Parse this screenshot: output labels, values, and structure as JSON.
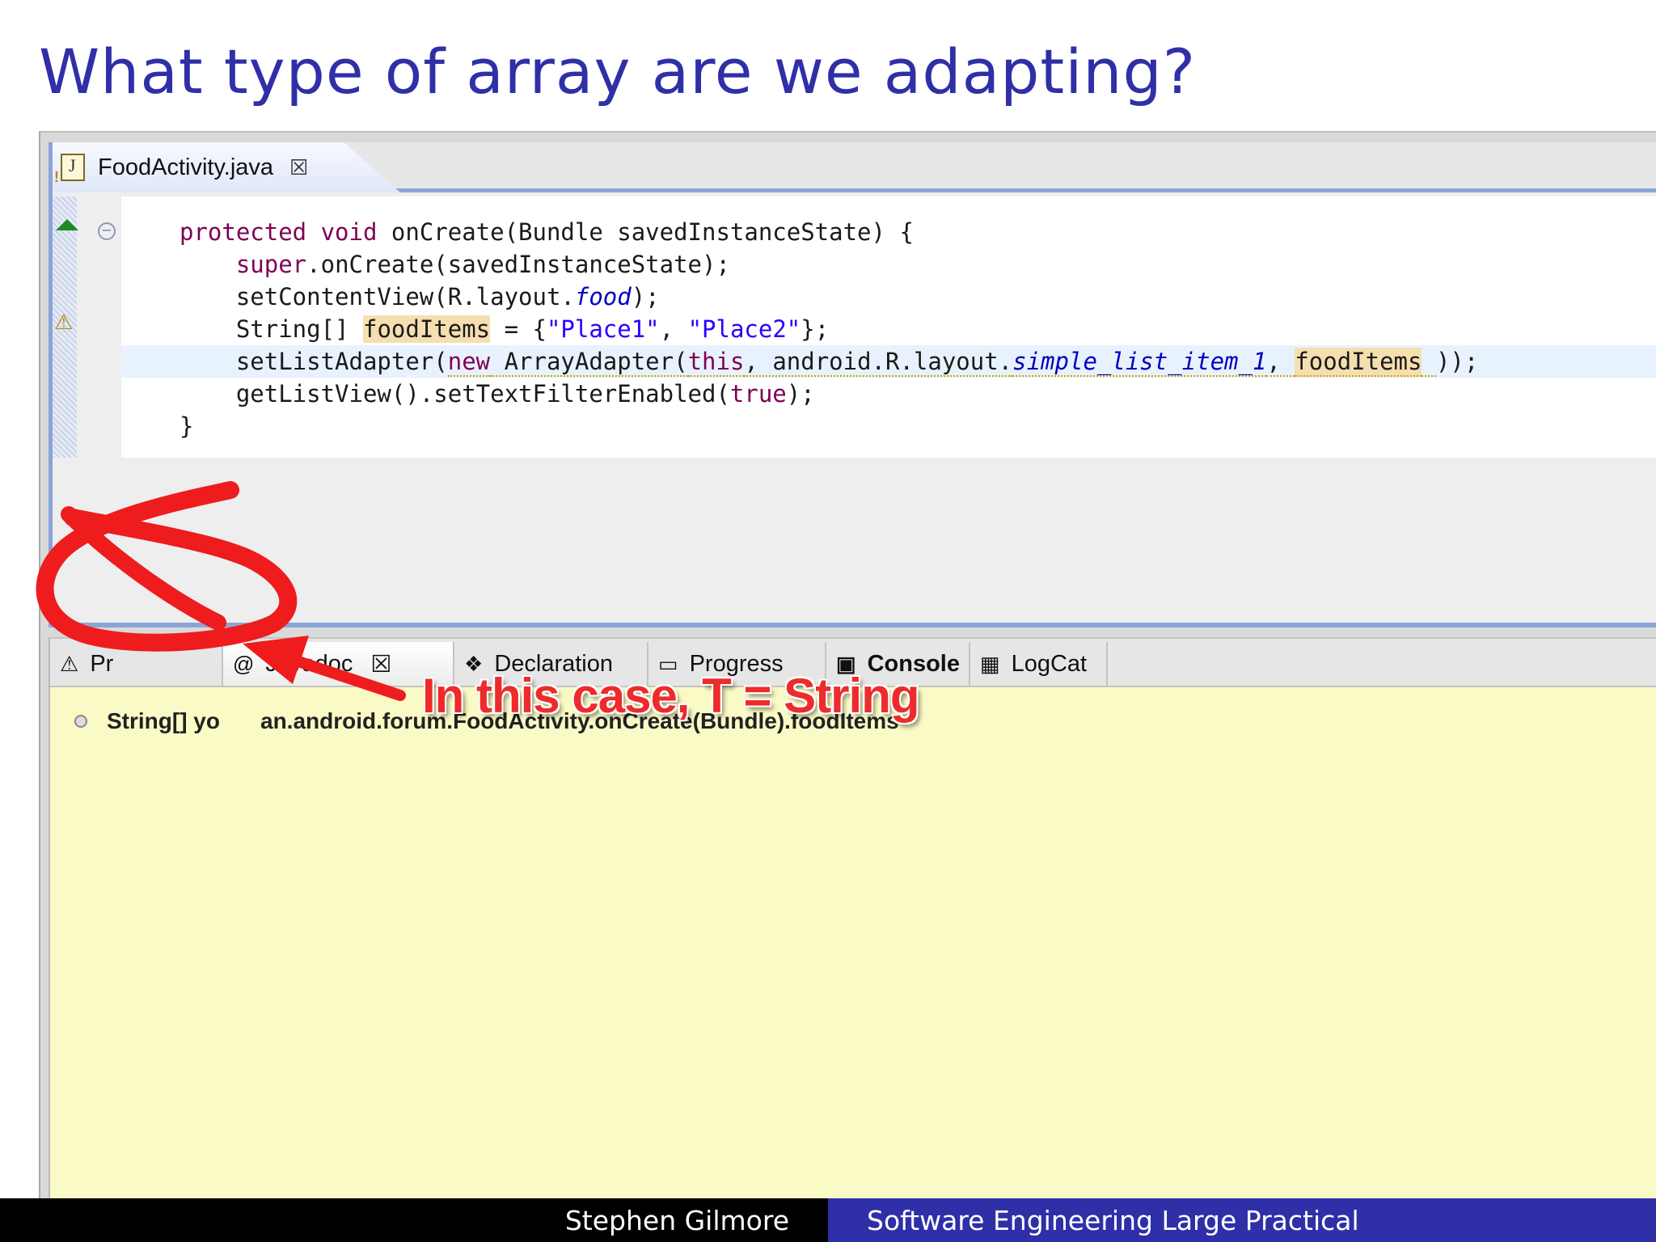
{
  "slide": {
    "title": "What type of array are we adapting?"
  },
  "editor": {
    "tab_label": "FoodActivity.java",
    "tab_close": "☒",
    "code_lines": [
      {
        "tokens": [
          {
            "t": "protected void",
            "c": "kw"
          },
          {
            "t": " onCreate(Bundle savedInstanceState) {"
          }
        ]
      },
      {
        "tokens": [
          {
            "t": "    "
          },
          {
            "t": "super",
            "c": "kw"
          },
          {
            "t": ".onCreate(savedInstanceState);"
          }
        ]
      },
      {
        "tokens": [
          {
            "t": "    setContentView(R.layout."
          },
          {
            "t": "food",
            "c": "ital"
          },
          {
            "t": ");"
          }
        ]
      },
      {
        "tokens": [
          {
            "t": "    String[] "
          },
          {
            "t": "foodItems",
            "c": "occ"
          },
          {
            "t": " = {"
          },
          {
            "t": "\"Place1\"",
            "c": "str"
          },
          {
            "t": ", "
          },
          {
            "t": "\"Place2\"",
            "c": "str"
          },
          {
            "t": "};"
          }
        ]
      },
      {
        "tokens": [
          {
            "t": "    setListAdapter("
          },
          {
            "t": "new",
            "c": "kw warn"
          },
          {
            "t": " ArrayAdapter(",
            "c": "warn"
          },
          {
            "t": "this",
            "c": "kw warn"
          },
          {
            "t": ", android.R.layout.",
            "c": "warn"
          },
          {
            "t": "simple_list_item_1",
            "c": "ital warn"
          },
          {
            "t": ", ",
            "c": "warn"
          },
          {
            "t": "foodItems",
            "c": "occ warn"
          },
          {
            "t": " ",
            "c": "warn"
          },
          {
            "t": "));"
          }
        ],
        "highlight": true
      },
      {
        "tokens": [
          {
            "t": "    getListView().setTextFilterEnabled("
          },
          {
            "t": "true",
            "c": "kw"
          },
          {
            "t": ");"
          }
        ]
      },
      {
        "tokens": [
          {
            "t": "}"
          }
        ]
      }
    ]
  },
  "panel": {
    "tabs": [
      {
        "label": "Pr",
        "icon": "problems-icon"
      },
      {
        "label": "Javadoc",
        "icon": "at-icon",
        "active": true,
        "close": "☒"
      },
      {
        "label": "Declaration",
        "icon": "declaration-icon"
      },
      {
        "label": "Progress",
        "icon": "progress-icon"
      },
      {
        "label": "Console",
        "icon": "console-icon",
        "bold": true
      },
      {
        "label": "LogCat",
        "icon": "logcat-icon"
      }
    ],
    "doc_text_left": "String[] yo",
    "doc_text_right": "an.android.forum.FoodActivity.onCreate(Bundle).foodItems"
  },
  "annotation": {
    "note": "In this case, T = String",
    "color": "#ee2b2b"
  },
  "footer": {
    "author": "Stephen Gilmore",
    "course": "Software Engineering Large Practical"
  }
}
